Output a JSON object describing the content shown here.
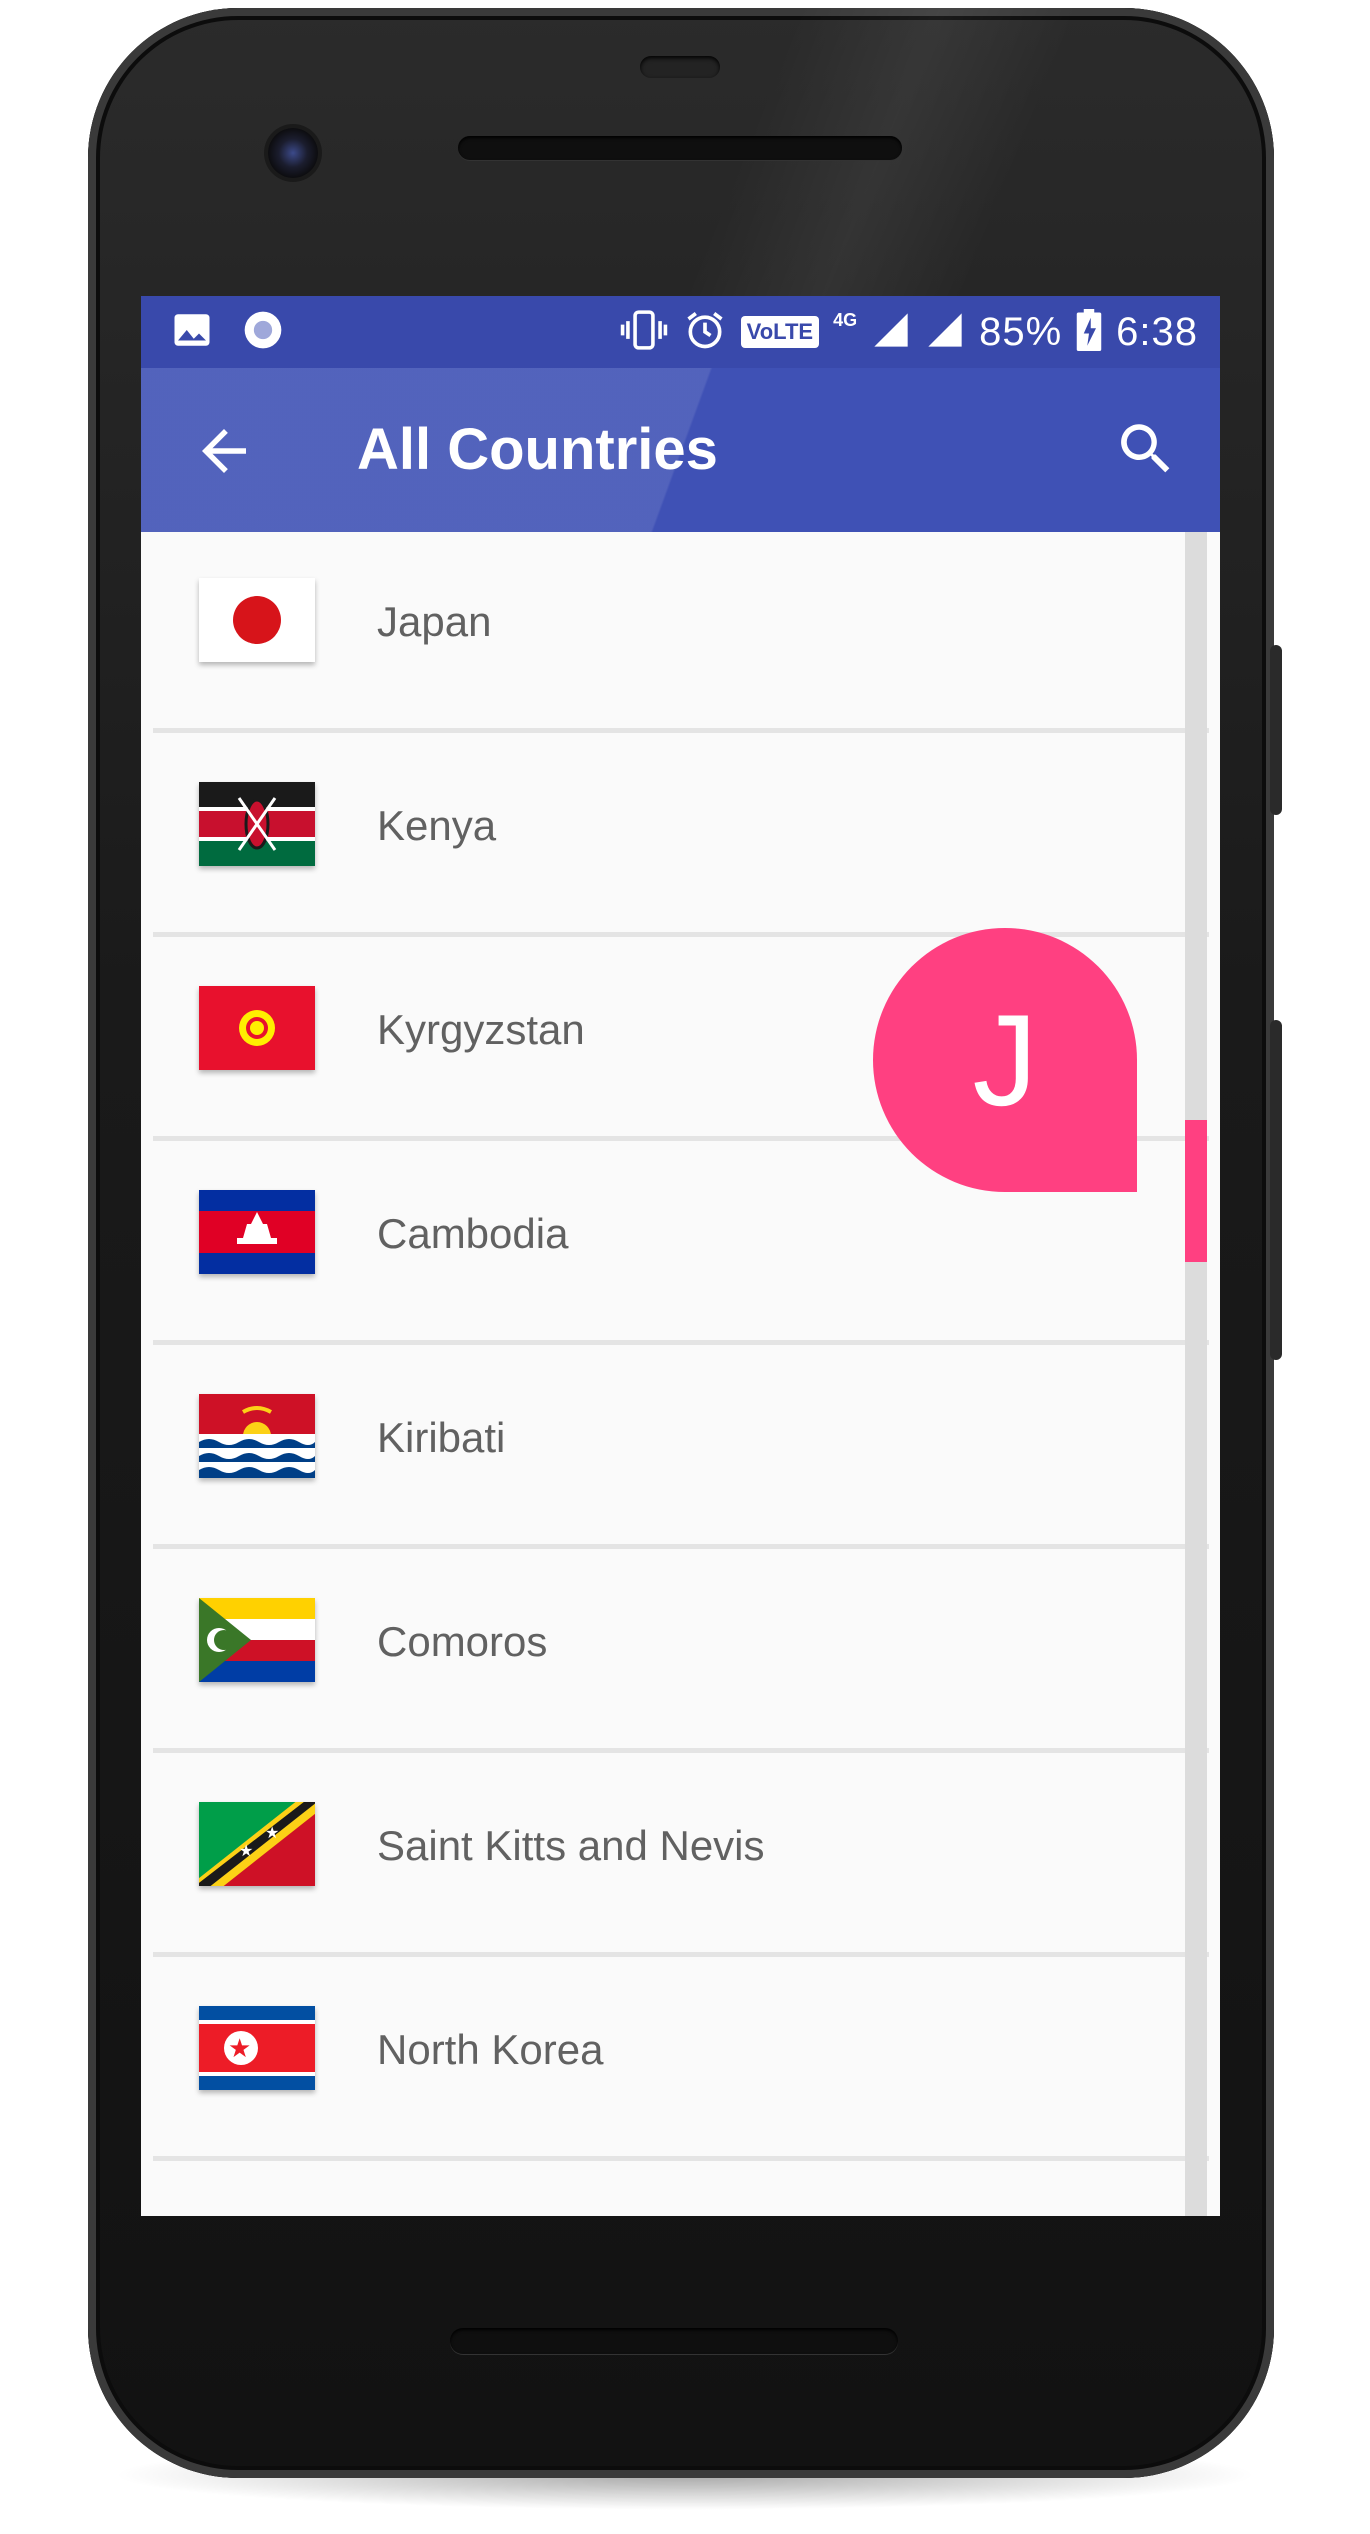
{
  "status_bar": {
    "battery": "85%",
    "time": "6:38",
    "volte": "VoLTE",
    "network": "4G",
    "icons": [
      "image-icon",
      "record-icon",
      "vibrate-icon",
      "alarm-icon",
      "volte-icon",
      "signal-icon",
      "signal-icon",
      "battery-charging-icon"
    ]
  },
  "app_bar": {
    "title": "All Countries",
    "back_icon": "arrow-back-icon",
    "search_icon": "search-icon",
    "color": "#3f51b5"
  },
  "countries": [
    {
      "name": "Japan",
      "flag": "japan-flag"
    },
    {
      "name": "Kenya",
      "flag": "kenya-flag"
    },
    {
      "name": "Kyrgyzstan",
      "flag": "kyrgyzstan-flag"
    },
    {
      "name": "Cambodia",
      "flag": "cambodia-flag"
    },
    {
      "name": "Kiribati",
      "flag": "kiribati-flag"
    },
    {
      "name": "Comoros",
      "flag": "comoros-flag"
    },
    {
      "name": "Saint Kitts and Nevis",
      "flag": "saint-kitts-and-nevis-flag"
    },
    {
      "name": "North Korea",
      "flag": "north-korea-flag"
    }
  ],
  "fast_scroller": {
    "letter": "J",
    "accent": "#ff4081"
  }
}
